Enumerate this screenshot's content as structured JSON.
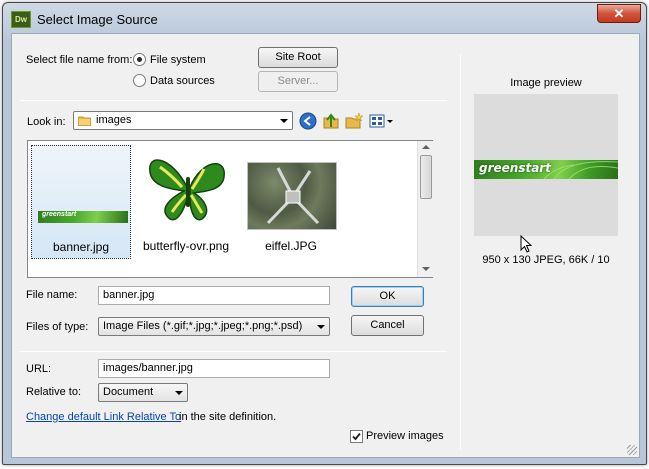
{
  "window": {
    "title": "Select Image Source",
    "app_icon_text": "Dw",
    "close_glyph": "✕"
  },
  "source": {
    "label": "Select file name from:",
    "options": [
      "File system",
      "Data sources"
    ],
    "selected": "File system",
    "site_root_label": "Site Root",
    "server_label": "Server..."
  },
  "look_in": {
    "label": "Look in:",
    "value": "images"
  },
  "files": [
    {
      "name": "banner.jpg",
      "selected": true
    },
    {
      "name": "butterfly-ovr.png",
      "selected": false
    },
    {
      "name": "eiffel.JPG",
      "selected": false
    }
  ],
  "file_name": {
    "label": "File name:",
    "value": "banner.jpg"
  },
  "files_of_type": {
    "label": "Files of type:",
    "value": "Image Files (*.gif;*.jpg;*.jpeg;*.png;*.psd)"
  },
  "ok_label": "OK",
  "cancel_label": "Cancel",
  "url": {
    "label": "URL:",
    "value": "images/banner.jpg"
  },
  "relative_to": {
    "label": "Relative to:",
    "value": "Document"
  },
  "change_link": {
    "link_text": "Change default Link Relative To",
    "suffix": " in the site definition."
  },
  "preview_images": {
    "label": "Preview images",
    "checked": true
  },
  "preview": {
    "heading": "Image preview",
    "banner_text": "greenstart",
    "info": "950 x 130 JPEG, 66K / 10"
  },
  "colors": {
    "accent": "#3c7fb1",
    "banner_green": "#4aa82c"
  }
}
